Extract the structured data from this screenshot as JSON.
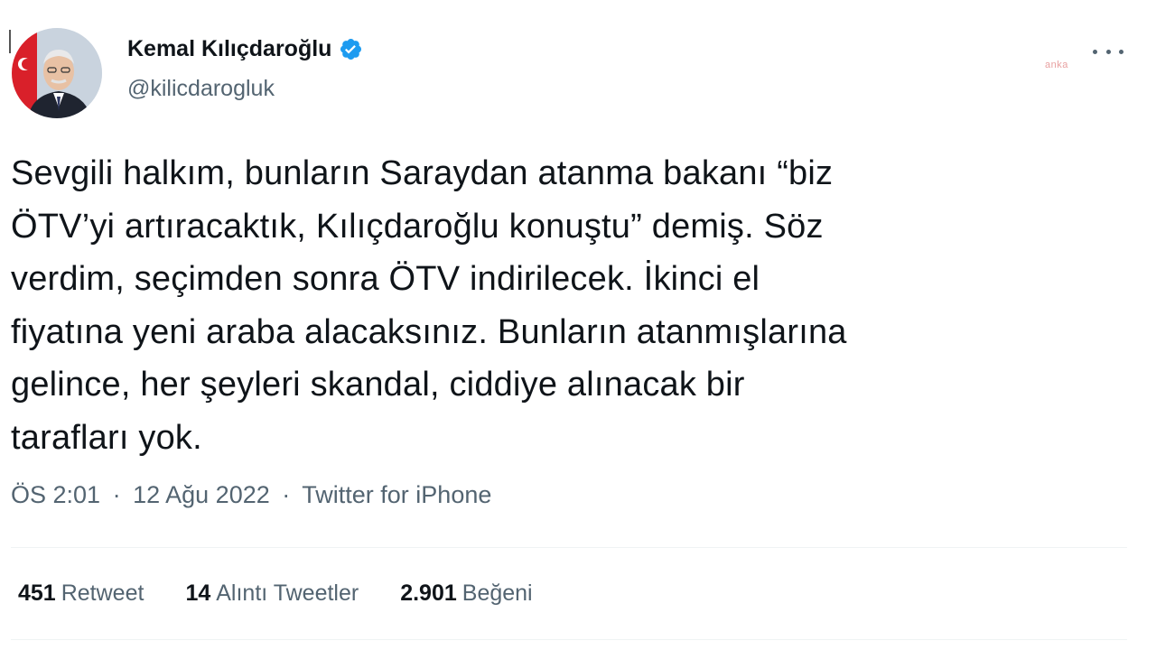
{
  "author": {
    "name": "Kemal Kılıçdaroğlu",
    "handle": "@kilicdarogluk",
    "verified": true,
    "accent_color": "#1d9bf0"
  },
  "watermark": "anka",
  "tweet": {
    "lines": [
      "Sevgili halkım, bunların Saraydan atanma bakanı “biz",
      "ÖTV’yi artıracaktık, Kılıçdaroğlu konuştu” demiş. Söz",
      "verdim, seçimden sonra ÖTV indirilecek. İkinci el",
      "fiyatına yeni araba alacaksınız. Bunların atanmışlarına",
      "gelince, her şeyleri skandal, ciddiye alınacak bir",
      "tarafları yok."
    ]
  },
  "meta": {
    "time": "ÖS 2:01",
    "date": "12 Ağu 2022",
    "separator": "·",
    "source": "Twitter for iPhone"
  },
  "stats": {
    "retweets": {
      "count": "451",
      "label": "Retweet"
    },
    "quotes": {
      "count": "14",
      "label": "Alıntı Tweetler"
    },
    "likes": {
      "count": "2.901",
      "label": "Beğeni"
    }
  },
  "icons": {
    "verified": "verified-badge-icon",
    "more": "more-options-icon"
  }
}
